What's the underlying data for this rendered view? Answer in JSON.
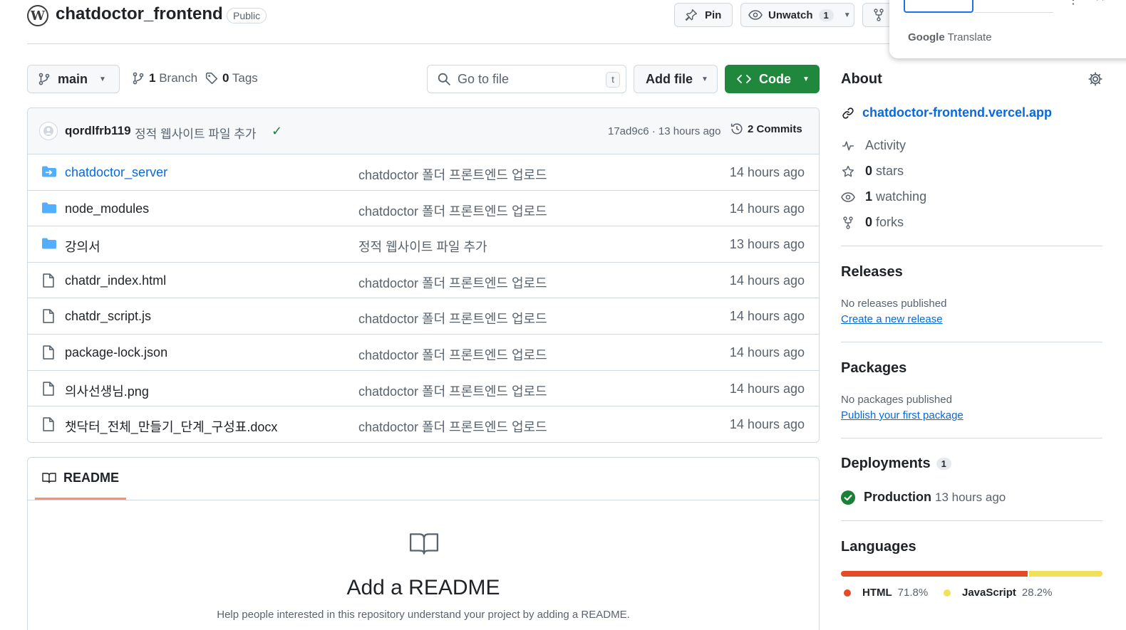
{
  "repo": {
    "name": "chatdoctor_frontend",
    "visibility": "Public"
  },
  "header_buttons": {
    "pin_label": "Pin",
    "watch_label": "Unwatch",
    "watch_count": "1"
  },
  "translate": {
    "brand_google": "Google",
    "brand_translate": "Translate"
  },
  "toolbar": {
    "branch": "main",
    "branch_count": "1",
    "branch_label": "Branch",
    "tag_count": "0",
    "tag_label": "Tags",
    "search_placeholder": "Go to file",
    "search_shortcut": "t",
    "add_file_label": "Add file",
    "code_label": "Code"
  },
  "latest_commit": {
    "author": "qordlfrb119",
    "message": "정적 웹사이트 파일 추가",
    "hash": "17ad9c6",
    "time": "13 hours ago",
    "commits_label": "2 Commits"
  },
  "files": [
    {
      "name": "chatdoctor_server",
      "type": "submodule",
      "message": "chatdoctor 폴더 프론트엔드 업로드",
      "time": "14 hours ago"
    },
    {
      "name": "node_modules",
      "type": "folder",
      "message": "chatdoctor 폴더 프론트엔드 업로드",
      "time": "14 hours ago"
    },
    {
      "name": "강의서",
      "type": "folder",
      "message": "정적 웹사이트 파일 추가",
      "time": "13 hours ago"
    },
    {
      "name": "chatdr_index.html",
      "type": "file",
      "message": "chatdoctor 폴더 프론트엔드 업로드",
      "time": "14 hours ago"
    },
    {
      "name": "chatdr_script.js",
      "type": "file",
      "message": "chatdoctor 폴더 프론트엔드 업로드",
      "time": "14 hours ago"
    },
    {
      "name": "package-lock.json",
      "type": "file",
      "message": "chatdoctor 폴더 프론트엔드 업로드",
      "time": "14 hours ago"
    },
    {
      "name": "의사선생님.png",
      "type": "file",
      "message": "chatdoctor 폴더 프론트엔드 업로드",
      "time": "14 hours ago"
    },
    {
      "name": "챗닥터_전체_만들기_단계_구성표.docx",
      "type": "file",
      "message": "chatdoctor 폴더 프론트엔드 업로드",
      "time": "14 hours ago"
    }
  ],
  "readme": {
    "tab_label": "README",
    "title": "Add a README",
    "description": "Help people interested in this repository understand your project by adding a README."
  },
  "about": {
    "title": "About",
    "website": "chatdoctor-frontend.vercel.app",
    "activity_label": "Activity",
    "stars_count": "0",
    "stars_label": "stars",
    "watching_count": "1",
    "watching_label": "watching",
    "forks_count": "0",
    "forks_label": "forks"
  },
  "releases": {
    "title": "Releases",
    "note": "No releases published",
    "link": "Create a new release"
  },
  "packages": {
    "title": "Packages",
    "note": "No packages published",
    "link": "Publish your first package"
  },
  "deployments": {
    "title": "Deployments",
    "count": "1",
    "env": "Production",
    "time": "13 hours ago"
  },
  "languages": {
    "title": "Languages",
    "items": [
      {
        "name": "HTML",
        "percent": "71.8%",
        "fraction": 0.718,
        "color": "#e34c26"
      },
      {
        "name": "JavaScript",
        "percent": "28.2%",
        "fraction": 0.282,
        "color": "#f1e05a"
      }
    ]
  }
}
